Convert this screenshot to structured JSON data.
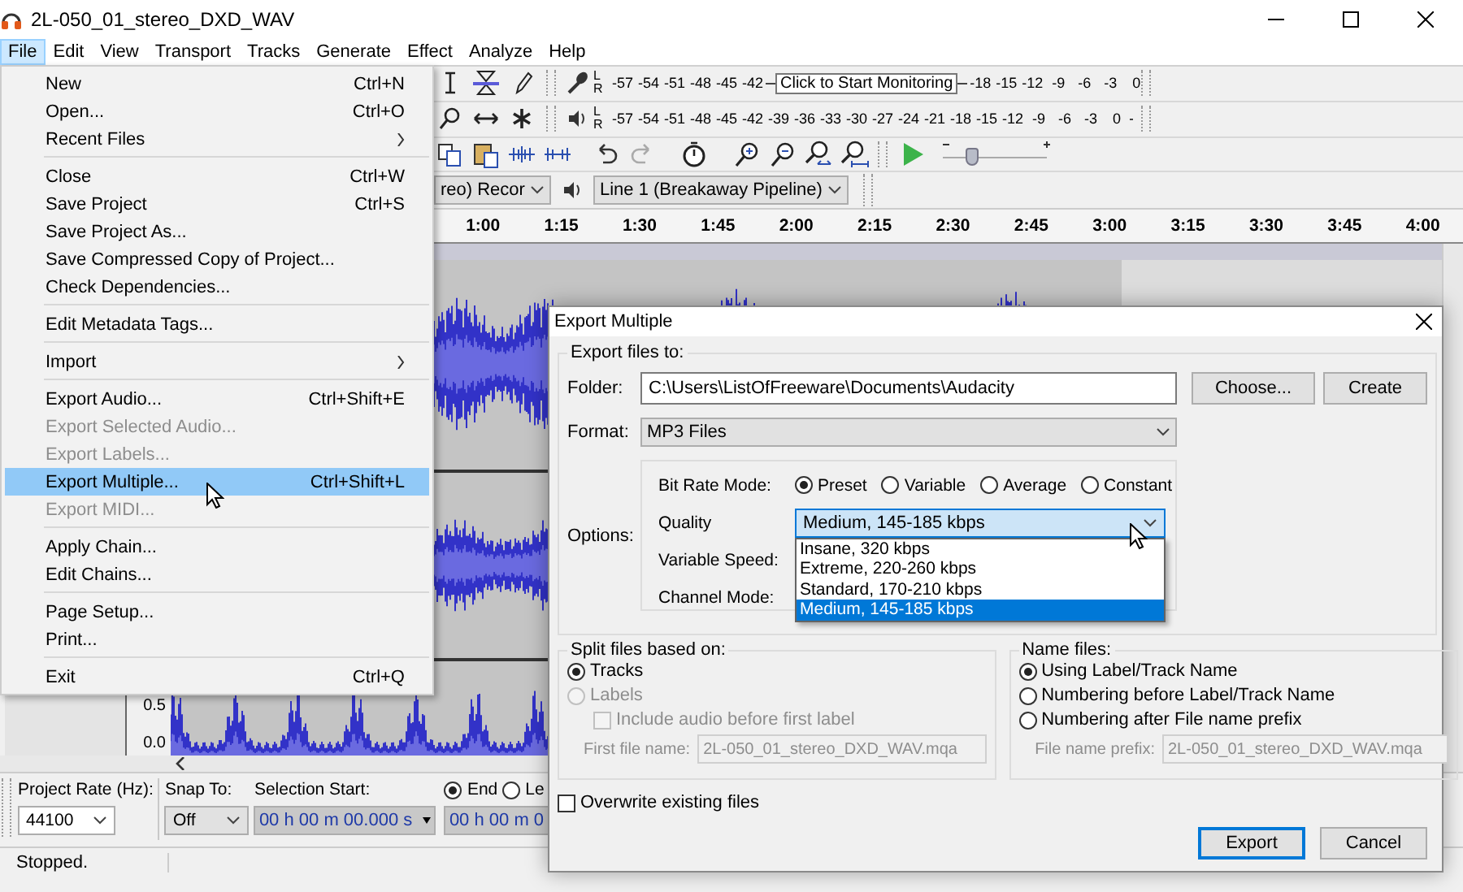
{
  "window": {
    "title": "2L-050_01_stereo_DXD_WAV"
  },
  "menubar": [
    {
      "label": "File",
      "selected": true
    },
    {
      "label": "Edit",
      "selected": false
    },
    {
      "label": "View",
      "selected": false
    },
    {
      "label": "Transport",
      "selected": false
    },
    {
      "label": "Tracks",
      "selected": false
    },
    {
      "label": "Generate",
      "selected": false
    },
    {
      "label": "Effect",
      "selected": false
    },
    {
      "label": "Analyze",
      "selected": false
    },
    {
      "label": "Help",
      "selected": false
    }
  ],
  "meters": [
    {
      "kind": "record",
      "channels": [
        "L",
        "R"
      ],
      "ticks": [
        "-57",
        "-54",
        "-51",
        "-48",
        "-45",
        "-42"
      ],
      "tooltip": "Click to Start Monitoring",
      "ticks_after": [
        "-18",
        "-15",
        "-12",
        "-9",
        "-6",
        "-3",
        "0"
      ]
    },
    {
      "kind": "playback",
      "channels": [
        "L",
        "R"
      ],
      "ticks": [
        "-57",
        "-54",
        "-51",
        "-48",
        "-45",
        "-42",
        "-39",
        "-36",
        "-33",
        "-30",
        "-27",
        "-24",
        "-21",
        "-18",
        "-15",
        "-12",
        "-9",
        "-6",
        "-3",
        "0"
      ]
    }
  ],
  "speed_slider": {
    "level": 0.28
  },
  "devices": [
    {
      "kind": "record",
      "value": "reo) Recor"
    },
    {
      "kind": "playback",
      "value": "Line 1 (Breakaway Pipeline)"
    }
  ],
  "ruler": {
    "ticks": [
      "1:00",
      "1:15",
      "1:30",
      "1:45",
      "2:00",
      "2:15",
      "2:30",
      "2:45",
      "3:00",
      "3:15",
      "3:30",
      "3:45",
      "4:00"
    ]
  },
  "track_scale": [
    "0.5",
    "0.0"
  ],
  "selection_toolbar": {
    "project_rate": {
      "label": "Project Rate (Hz):",
      "value": "44100"
    },
    "snap_to": {
      "label": "Snap To:",
      "value": "Off"
    },
    "selection_start": {
      "label": "Selection Start:",
      "value": "00 h 00 m 00.000 s"
    },
    "end_options": [
      {
        "label": "End",
        "selected": true
      },
      {
        "label": "Le",
        "selected": false
      }
    ],
    "end_value": "00 h 00 m 0"
  },
  "status_bar": {
    "text": "Stopped."
  },
  "file_menu": {
    "groups": [
      [
        {
          "label": "New",
          "shortcut": "Ctrl+N",
          "disabled": false,
          "selected": false,
          "submenu": false
        },
        {
          "label": "Open...",
          "shortcut": "Ctrl+O",
          "disabled": false,
          "selected": false,
          "submenu": false
        },
        {
          "label": "Recent Files",
          "disabled": false,
          "selected": false,
          "submenu": true
        }
      ],
      [
        {
          "label": "Close",
          "shortcut": "Ctrl+W",
          "disabled": false,
          "selected": false,
          "submenu": false
        },
        {
          "label": "Save Project",
          "shortcut": "Ctrl+S",
          "disabled": false,
          "selected": false,
          "submenu": false
        },
        {
          "label": "Save Project As...",
          "disabled": false,
          "selected": false,
          "submenu": false
        },
        {
          "label": "Save Compressed Copy of Project...",
          "disabled": false,
          "selected": false,
          "submenu": false
        },
        {
          "label": "Check Dependencies...",
          "disabled": false,
          "selected": false,
          "submenu": false
        }
      ],
      [
        {
          "label": "Edit Metadata Tags...",
          "disabled": false,
          "selected": false,
          "submenu": false
        }
      ],
      [
        {
          "label": "Import",
          "disabled": false,
          "selected": false,
          "submenu": true
        }
      ],
      [
        {
          "label": "Export Audio...",
          "shortcut": "Ctrl+Shift+E",
          "disabled": false,
          "selected": false,
          "submenu": false
        },
        {
          "label": "Export Selected Audio...",
          "disabled": true,
          "selected": false,
          "submenu": false
        },
        {
          "label": "Export Labels...",
          "disabled": true,
          "selected": false,
          "submenu": false
        },
        {
          "label": "Export Multiple...",
          "shortcut": "Ctrl+Shift+L",
          "disabled": false,
          "selected": true,
          "submenu": false
        },
        {
          "label": "Export MIDI...",
          "disabled": true,
          "selected": false,
          "submenu": false
        }
      ],
      [
        {
          "label": "Apply Chain...",
          "disabled": false,
          "selected": false,
          "submenu": false
        },
        {
          "label": "Edit Chains...",
          "disabled": false,
          "selected": false,
          "submenu": false
        }
      ],
      [
        {
          "label": "Page Setup...",
          "disabled": false,
          "selected": false,
          "submenu": false
        },
        {
          "label": "Print...",
          "disabled": false,
          "selected": false,
          "submenu": false
        }
      ],
      [
        {
          "label": "Exit",
          "shortcut": "Ctrl+Q",
          "disabled": false,
          "selected": false,
          "submenu": false
        }
      ]
    ]
  },
  "dialog": {
    "title": "Export Multiple",
    "export_group": "Export files to:",
    "folder": {
      "label": "Folder:",
      "value": "C:\\Users\\ListOfFreeware\\Documents\\Audacity"
    },
    "folder_buttons": [
      "Choose...",
      "Create"
    ],
    "format": {
      "label": "Format:",
      "value": "MP3 Files"
    },
    "options_label": "Options:",
    "bit_rate_mode": {
      "label": "Bit Rate Mode:",
      "options": [
        {
          "label": "Preset",
          "selected": true
        },
        {
          "label": "Variable",
          "selected": false
        },
        {
          "label": "Average",
          "selected": false
        },
        {
          "label": "Constant",
          "selected": false
        }
      ]
    },
    "quality": {
      "label": "Quality",
      "value": "Medium, 145-185 kbps",
      "expanded": true,
      "options": [
        {
          "label": "Insane, 320 kbps",
          "selected": false
        },
        {
          "label": "Extreme, 220-260 kbps",
          "selected": false
        },
        {
          "label": "Standard, 170-210 kbps",
          "selected": false
        },
        {
          "label": "Medium, 145-185 kbps",
          "selected": true
        }
      ]
    },
    "other_labels": [
      "Variable Speed:",
      "Channel Mode:"
    ],
    "split": {
      "title": "Split files based on:",
      "options": [
        {
          "label": "Tracks",
          "selected": true,
          "disabled": false
        },
        {
          "label": "Labels",
          "selected": false,
          "disabled": true
        }
      ],
      "include_audio": {
        "label": "Include audio before first label",
        "checked": false,
        "disabled": true
      },
      "first_file_name": {
        "label": "First file name:",
        "value": "2L-050_01_stereo_DXD_WAV.mqa",
        "disabled": true
      }
    },
    "name_files": {
      "title": "Name files:",
      "options": [
        {
          "label": "Using Label/Track Name",
          "selected": true,
          "disabled": false
        },
        {
          "label": "Numbering before Label/Track Name",
          "selected": false,
          "disabled": false
        },
        {
          "label": "Numbering after File name prefix",
          "selected": false,
          "disabled": false
        }
      ],
      "prefix": {
        "label": "File name prefix:",
        "value": "2L-050_01_stereo_DXD_WAV.mqa",
        "disabled": true
      }
    },
    "overwrite": {
      "label": "Overwrite existing files",
      "checked": false
    },
    "buttons": [
      {
        "label": "Export",
        "default": true
      },
      {
        "label": "Cancel",
        "default": false
      }
    ]
  }
}
